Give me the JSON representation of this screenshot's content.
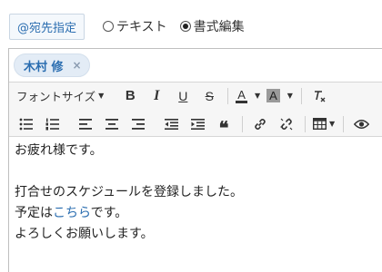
{
  "recipient_button": {
    "label": "@宛先指定"
  },
  "format_mode": {
    "options": [
      {
        "label": "テキスト",
        "selected": false
      },
      {
        "label": "書式編集",
        "selected": true
      }
    ]
  },
  "recipients": [
    {
      "name": "木村 修",
      "remove_icon": "×"
    }
  ],
  "toolbar": {
    "font_size_label": "フォントサイズ",
    "bold": "B",
    "italic": "I",
    "underline": "U",
    "strike": "S",
    "text_color": "A",
    "bg_color": "A",
    "clear_format": "Tx",
    "quote": "❝"
  },
  "message": {
    "line1": "お疲れ様です。",
    "line2": "",
    "line3": "打合せのスケジュールを登録しました。",
    "line4_prefix": "予定は",
    "line4_link": "こちら",
    "line4_suffix": "です。",
    "line5": "よろしくお願いします。"
  },
  "colors": {
    "accent": "#2a6db0",
    "chip_bg": "#e3ecf6",
    "toolbar_bg": "#f6f6f6"
  }
}
